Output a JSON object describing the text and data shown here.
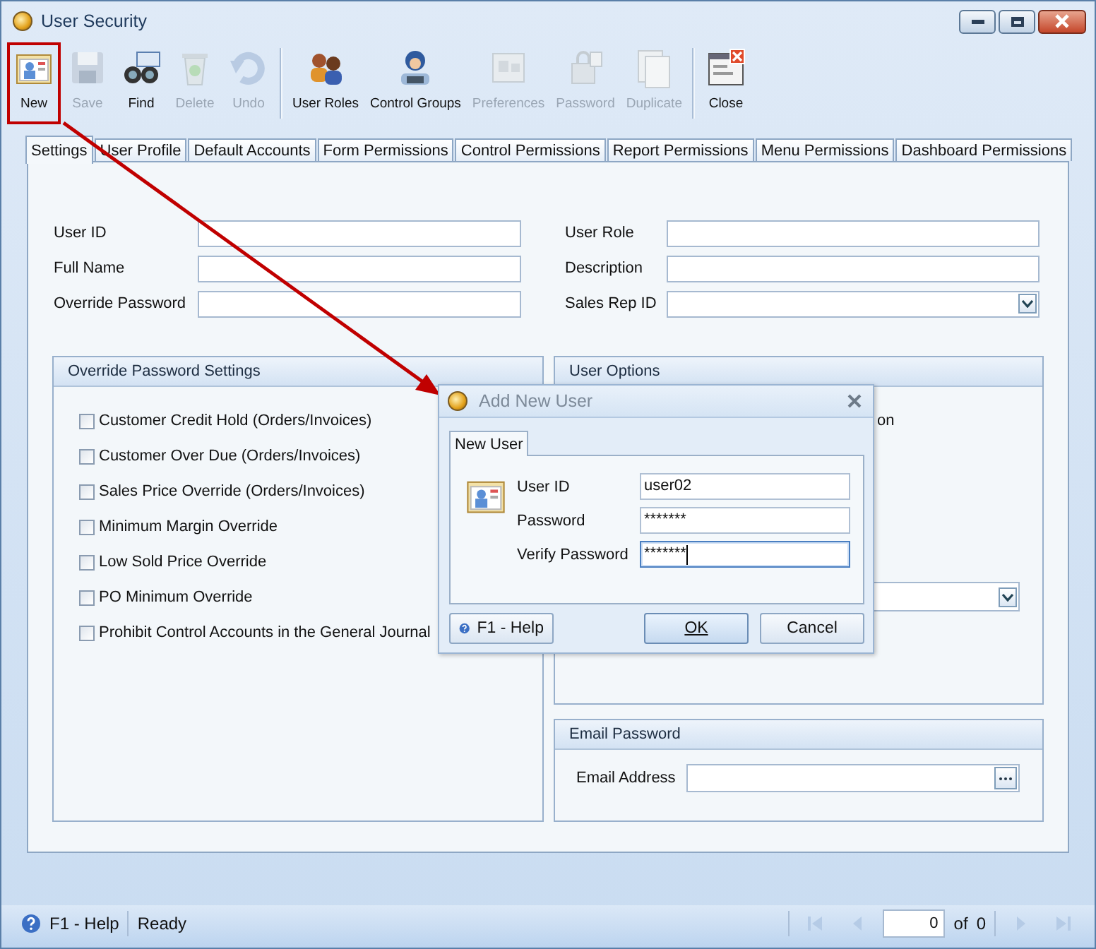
{
  "window": {
    "title": "User Security"
  },
  "toolbar": {
    "groups": [
      {
        "items": [
          {
            "label": "New",
            "disabled": false,
            "highlighted": true
          },
          {
            "label": "Save",
            "disabled": true,
            "highlighted": false
          },
          {
            "label": "Find",
            "disabled": false,
            "highlighted": false
          },
          {
            "label": "Delete",
            "disabled": true,
            "highlighted": false
          },
          {
            "label": "Undo",
            "disabled": true,
            "highlighted": false
          }
        ]
      },
      {
        "items": [
          {
            "label": "User Roles",
            "disabled": false,
            "highlighted": false
          },
          {
            "label": "Control Groups",
            "disabled": false,
            "highlighted": false
          },
          {
            "label": "Preferences",
            "disabled": true,
            "highlighted": false
          },
          {
            "label": "Password",
            "disabled": true,
            "highlighted": false
          },
          {
            "label": "Duplicate",
            "disabled": true,
            "highlighted": false
          }
        ]
      },
      {
        "items": [
          {
            "label": "Close",
            "disabled": false,
            "highlighted": false
          }
        ]
      }
    ]
  },
  "tabs": [
    {
      "label": "Settings",
      "selected": true
    },
    {
      "label": "User Profile",
      "selected": false
    },
    {
      "label": "Default Accounts",
      "selected": false
    },
    {
      "label": "Form Permissions",
      "selected": false
    },
    {
      "label": "Control Permissions",
      "selected": false
    },
    {
      "label": "Report Permissions",
      "selected": false
    },
    {
      "label": "Menu Permissions",
      "selected": false
    },
    {
      "label": "Dashboard Permissions",
      "selected": false
    }
  ],
  "form": {
    "left": [
      {
        "label": "User ID",
        "kind": "text"
      },
      {
        "label": "Full Name",
        "kind": "text"
      },
      {
        "label": "Override Password",
        "kind": "text"
      }
    ],
    "right": [
      {
        "label": "User Role",
        "kind": "text"
      },
      {
        "label": "Description",
        "kind": "text"
      },
      {
        "label": "Sales Rep ID",
        "kind": "dropdown"
      }
    ]
  },
  "override_password_settings": {
    "title": "Override Password Settings",
    "options": [
      {
        "label": "Customer Credit Hold (Orders/Invoices)",
        "checked": false
      },
      {
        "label": "Customer Over Due (Orders/Invoices)",
        "checked": false
      },
      {
        "label": "Sales Price Override (Orders/Invoices)",
        "checked": false
      },
      {
        "label": "Minimum Margin Override",
        "checked": false
      },
      {
        "label": "Low Sold Price Override",
        "checked": false
      },
      {
        "label": "PO Minimum Override",
        "checked": false
      },
      {
        "label": "Prohibit Control Accounts in the General Journal",
        "checked": false
      }
    ]
  },
  "user_options": {
    "title": "User Options",
    "visible_text": "on"
  },
  "email_password": {
    "title": "Email Password",
    "label": "Email Address"
  },
  "dialog": {
    "title": "Add New User",
    "tab": "New User",
    "fields": [
      {
        "label": "User ID",
        "value": "user02",
        "focused": false
      },
      {
        "label": "Password",
        "value": "*******",
        "focused": false
      },
      {
        "label": "Verify Password",
        "value": "*******",
        "focused": true
      }
    ],
    "help": "F1 - Help",
    "buttons": [
      "OK",
      "Cancel"
    ]
  },
  "status_bar": {
    "help": "F1 - Help",
    "status": "Ready",
    "page": "0",
    "of": "of",
    "total": "0"
  }
}
